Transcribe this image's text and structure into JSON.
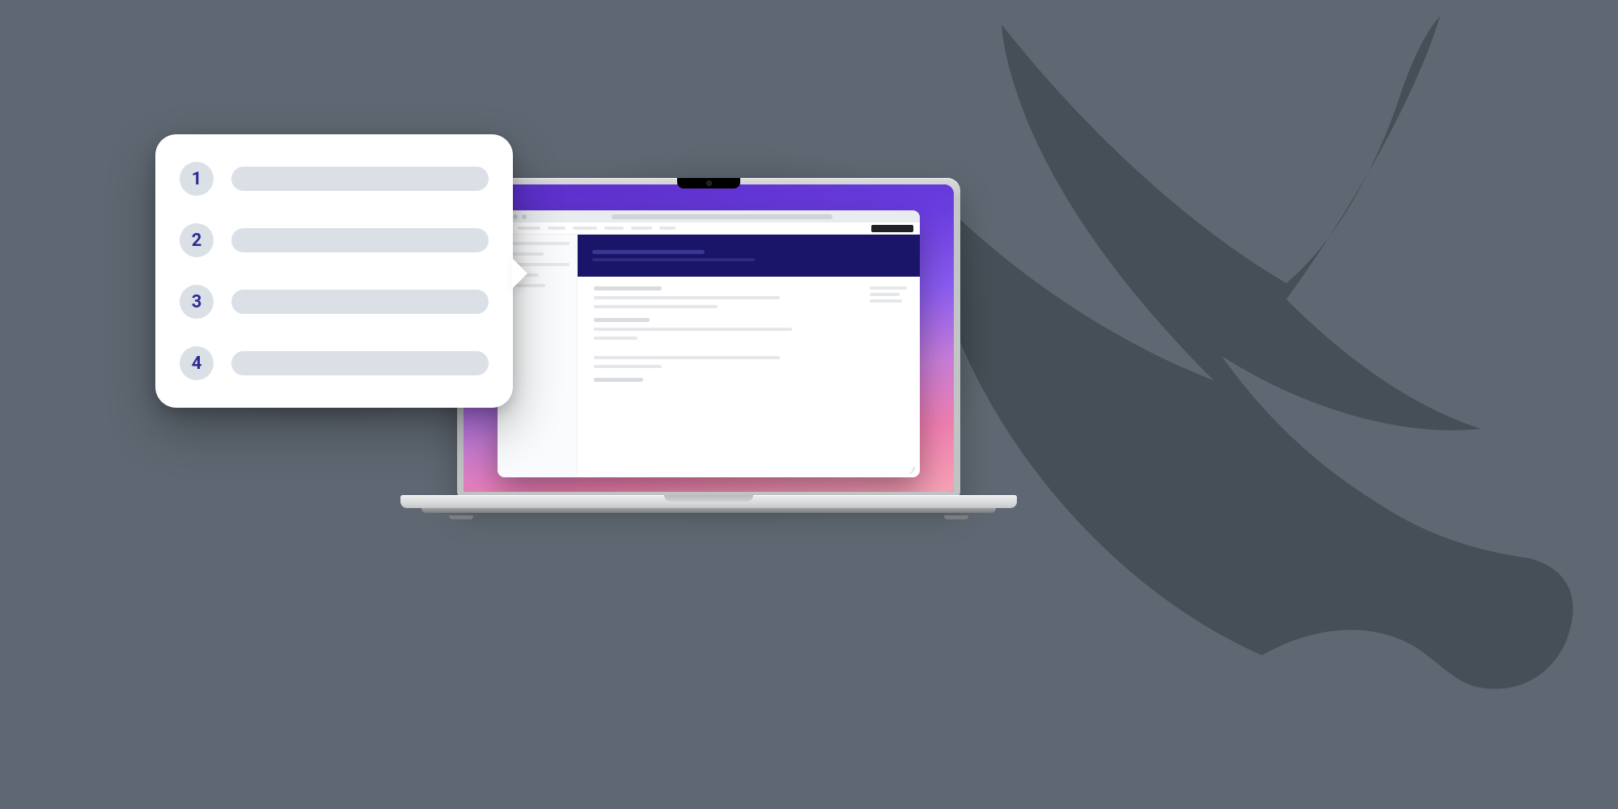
{
  "steps": [
    {
      "num": "1"
    },
    {
      "num": "2"
    },
    {
      "num": "3"
    },
    {
      "num": "4"
    }
  ],
  "colors": {
    "background": "#5f6872",
    "bird": "#464f57",
    "badge_text": "#2c2a91",
    "hero": "#1a1569"
  }
}
